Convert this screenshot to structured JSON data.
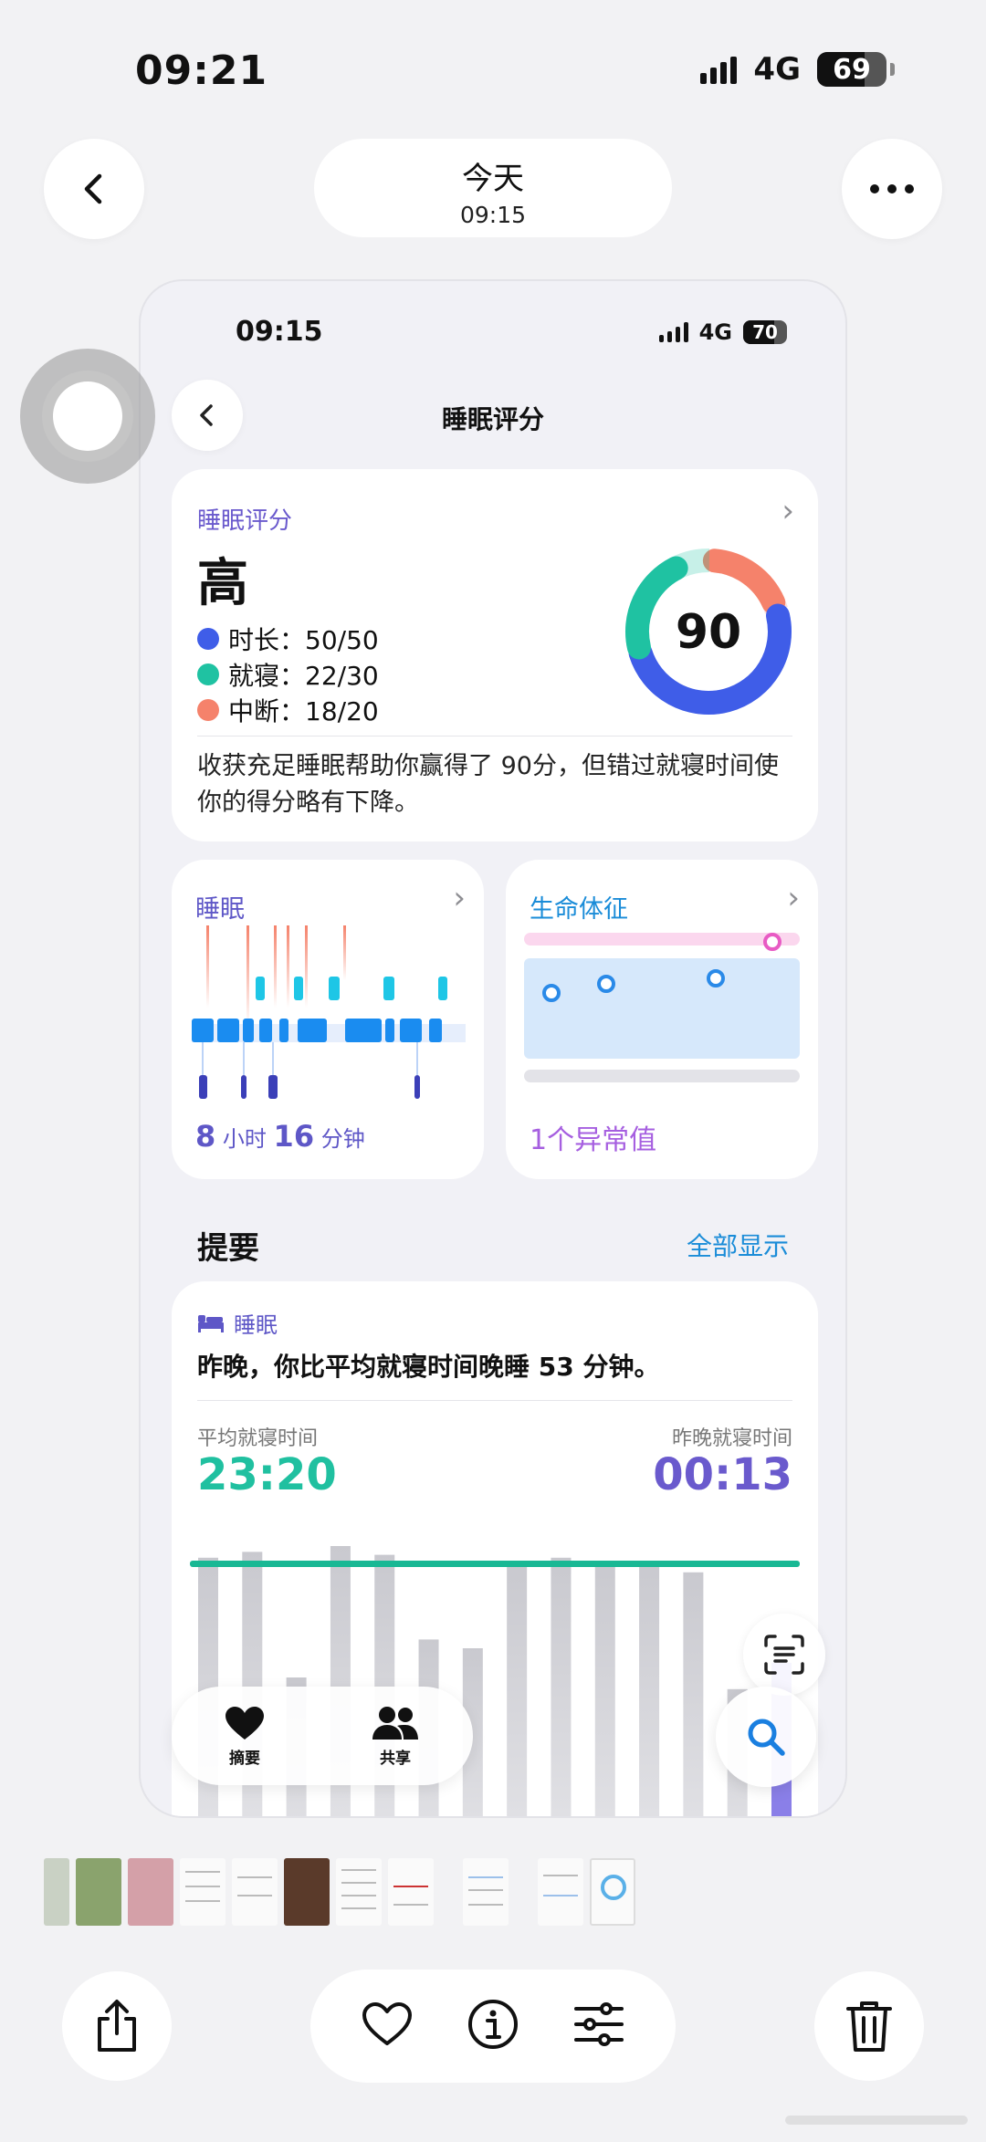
{
  "status": {
    "time": "09:21",
    "network": "4G",
    "battery": "69",
    "battery_level": 0.69
  },
  "nav": {
    "title": "今天",
    "subtitle": "09:15"
  },
  "inner": {
    "status": {
      "time": "09:15",
      "network": "4G",
      "battery": "70",
      "battery_level": 0.7
    },
    "title": "睡眠评分",
    "score_card": {
      "label": "睡眠评分",
      "level": "高",
      "score": "90",
      "rows": [
        {
          "text": "时长：50/50",
          "color": "#3f5de8",
          "value": 50,
          "max": 50
        },
        {
          "text": "就寝：22/30",
          "color": "#1fc2a2",
          "value": 22,
          "max": 30
        },
        {
          "text": "中断：18/20",
          "color": "#f5826b",
          "value": 18,
          "max": 20
        }
      ],
      "description": "收获充足睡眠帮助你赢得了 90分，但错过就寝时间使你的得分略有下降。"
    },
    "sleep_card": {
      "label": "睡眠",
      "hours": "8",
      "hours_unit": "小时",
      "minutes": "16",
      "minutes_unit": "分钟"
    },
    "vitals_card": {
      "label": "生命体征",
      "note": "1个异常值"
    },
    "highlights": {
      "title": "提要",
      "show_all": "全部显示",
      "tag": "睡眠",
      "text": "昨晚，你比平均就寝时间晚睡 53 分钟。",
      "avg_label": "平均就寝时间",
      "avg_value": "23:20",
      "last_label": "昨晚就寝时间",
      "last_value": "00:13",
      "bar_values": [
        0.96,
        0.98,
        0.55,
        1.0,
        0.97,
        0.68,
        0.65,
        0.94,
        0.96,
        0.95,
        0.95,
        0.91,
        0.51,
        0.6
      ]
    },
    "tabs": [
      {
        "label": "摘要",
        "icon": "heart-icon"
      },
      {
        "label": "共享",
        "icon": "people-icon"
      }
    ]
  },
  "colors": {
    "duration": "#3f5de8",
    "bedtime": "#1fc2a2",
    "interruption": "#f5826b",
    "purple": "#6a5acd",
    "link": "#1a8cd8"
  }
}
